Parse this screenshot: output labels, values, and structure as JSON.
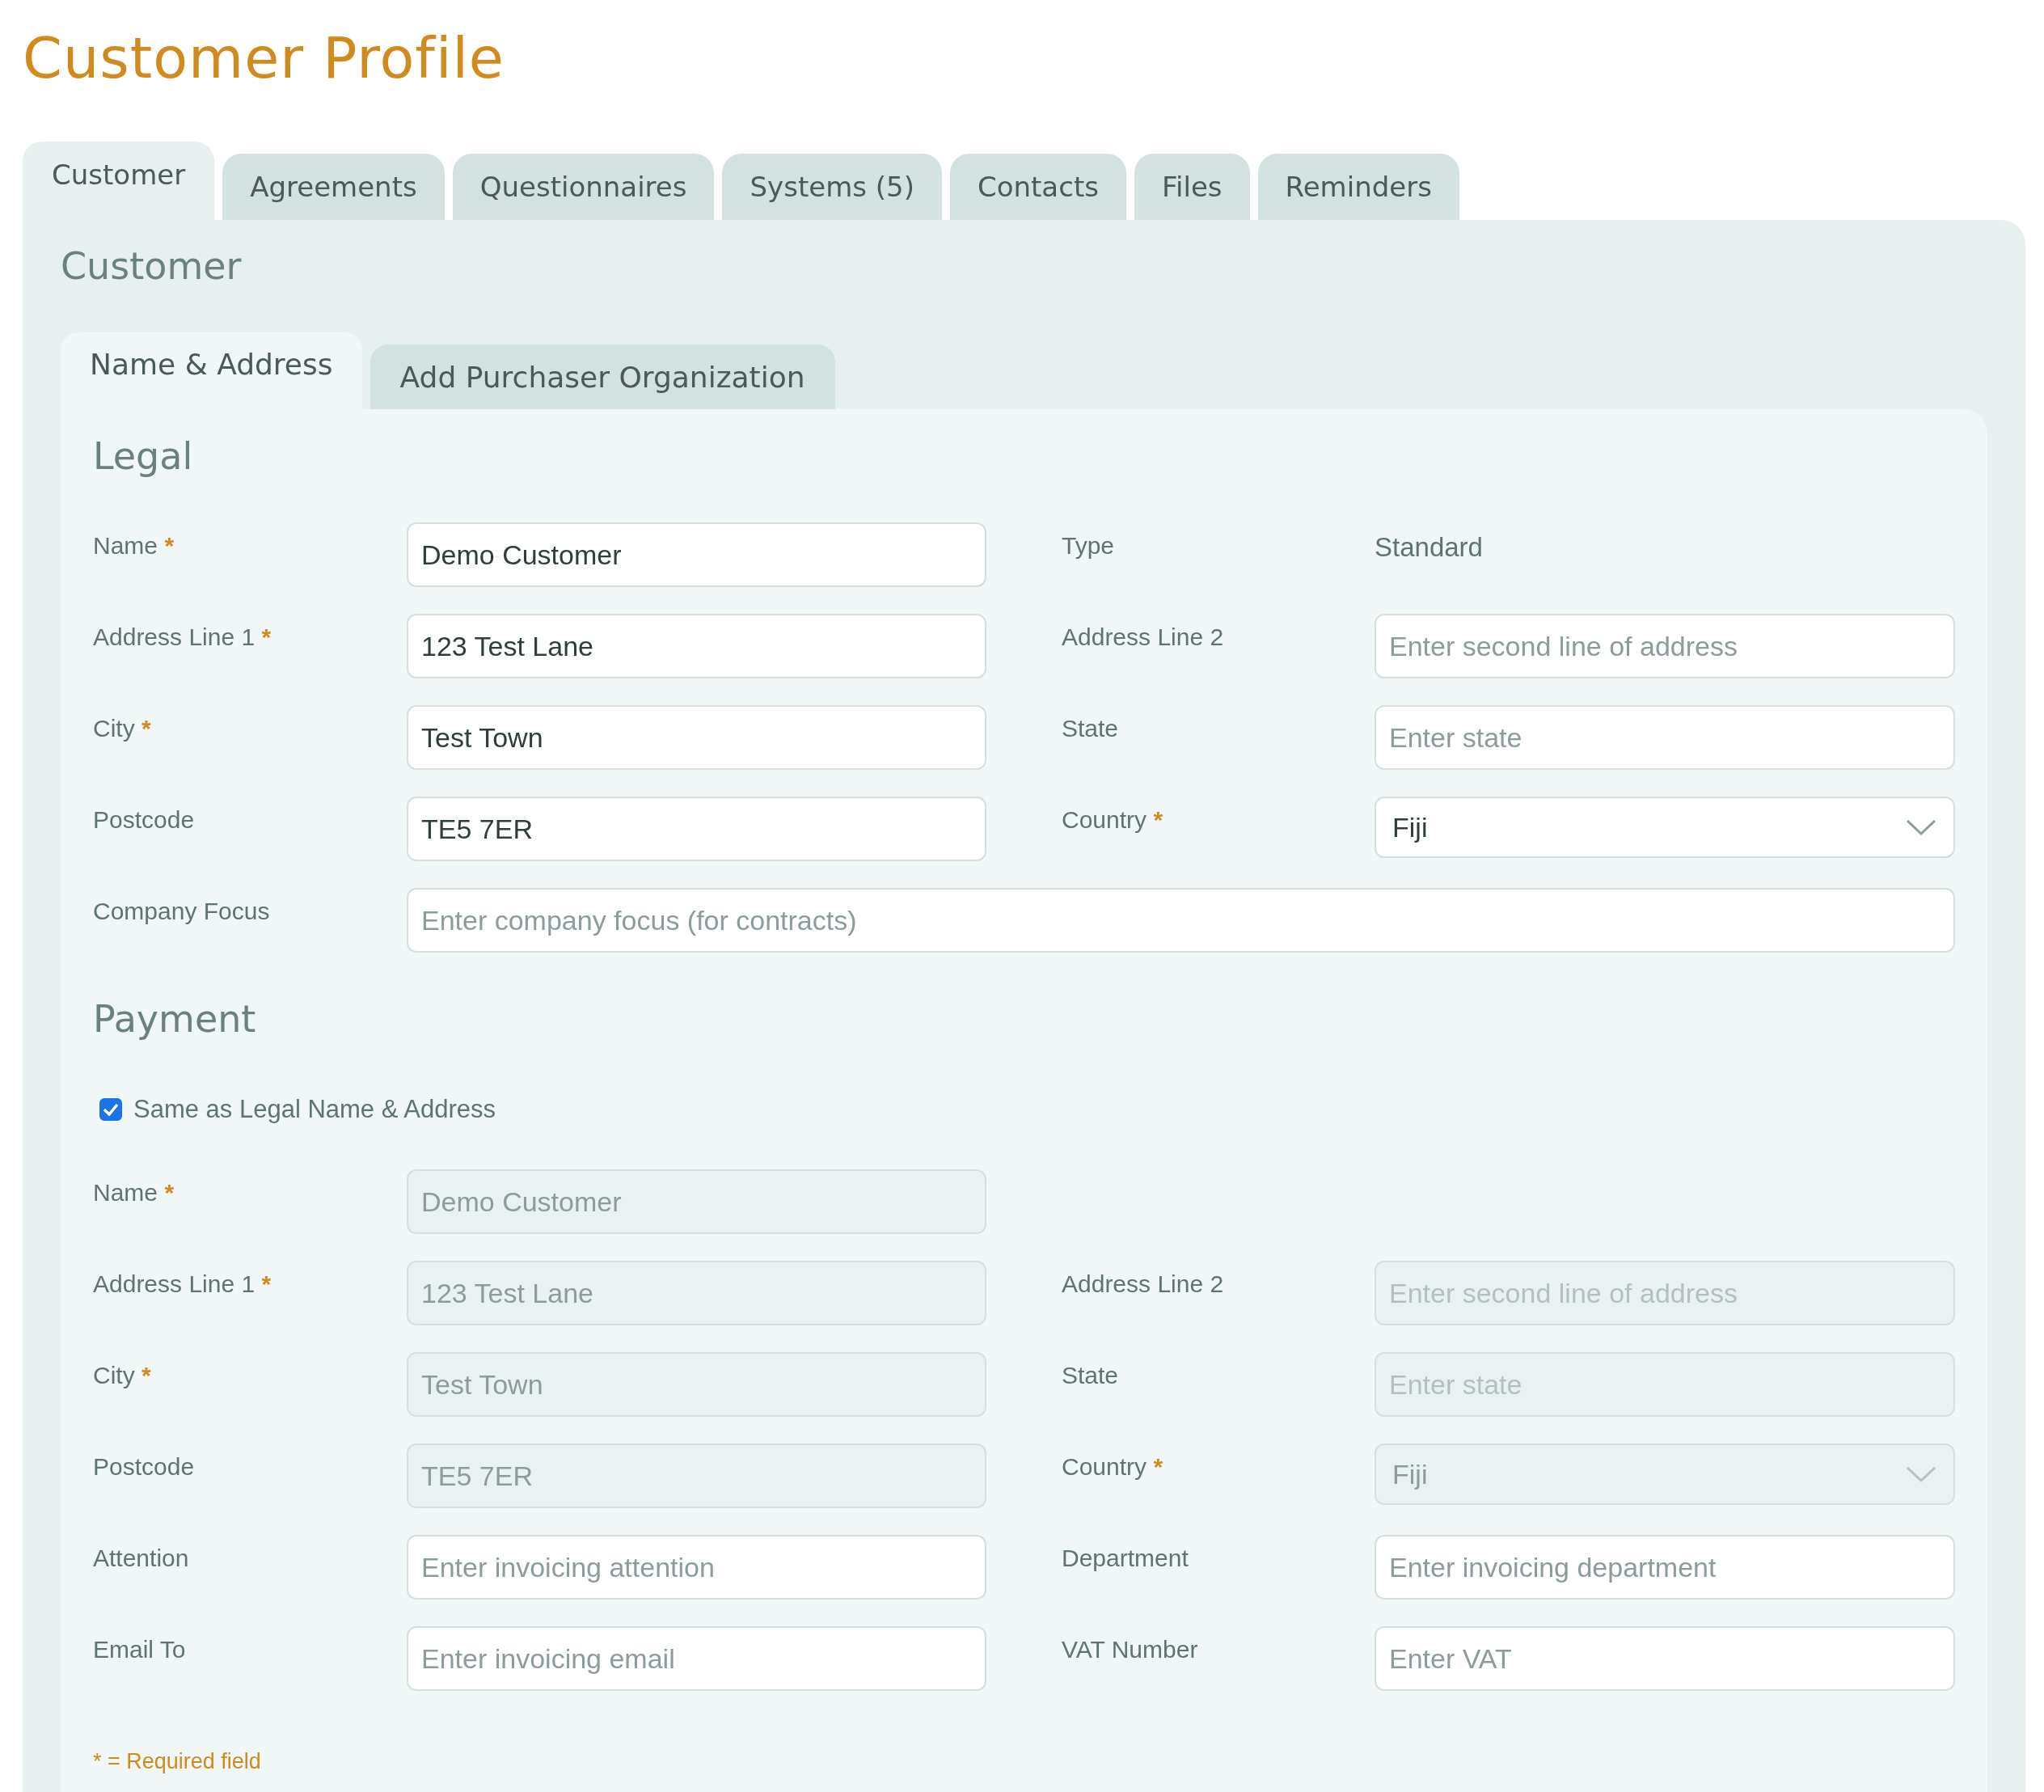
{
  "title": "Customer Profile",
  "tabs": [
    {
      "label": "Customer",
      "selected": true
    },
    {
      "label": "Agreements",
      "selected": false
    },
    {
      "label": "Questionnaires",
      "selected": false
    },
    {
      "label": "Systems (5)",
      "selected": false
    },
    {
      "label": "Contacts",
      "selected": false
    },
    {
      "label": "Files",
      "selected": false
    },
    {
      "label": "Reminders",
      "selected": false
    }
  ],
  "section": {
    "heading": "Customer",
    "subtabs": [
      {
        "label": "Name & Address",
        "selected": true
      },
      {
        "label": "Add Purchaser Organization",
        "selected": false
      }
    ],
    "legal": {
      "heading": "Legal",
      "rows": [
        {
          "fields": [
            {
              "kind": "input",
              "label": "Name",
              "mark": "*",
              "value": "Demo Customer",
              "disabled": false
            },
            {
              "kind": "static",
              "label": "Type",
              "value": "Standard"
            }
          ]
        },
        {
          "fields": [
            {
              "kind": "input",
              "label": "Address Line 1",
              "mark": "*",
              "value": "123 Test Lane",
              "disabled": false
            },
            {
              "kind": "input",
              "label": "Address Line 2",
              "placeholder": "Enter second line of address",
              "disabled": false
            }
          ]
        },
        {
          "fields": [
            {
              "kind": "input",
              "label": "City",
              "mark": "*",
              "value": "Test Town",
              "disabled": false
            },
            {
              "kind": "input",
              "label": "State",
              "placeholder": "Enter state",
              "disabled": false
            }
          ]
        },
        {
          "fields": [
            {
              "kind": "input",
              "label": "Postcode",
              "value": "TE5 7ER",
              "disabled": false
            },
            {
              "kind": "select",
              "label": "Country",
              "mark": "*",
              "value": "Fiji",
              "disabled": false
            }
          ]
        },
        {
          "fields": [
            {
              "kind": "input",
              "label": "Company Focus",
              "placeholder": "Enter company focus (for contracts)",
              "disabled": false,
              "wide": true
            }
          ]
        }
      ]
    },
    "payment": {
      "heading": "Payment",
      "same_as_legal": {
        "label": "Same as Legal Name & Address",
        "checked": true
      },
      "rows": [
        {
          "fields": [
            {
              "kind": "input",
              "label": "Name",
              "mark": "*",
              "value": "Demo Customer",
              "disabled": true
            }
          ]
        },
        {
          "fields": [
            {
              "kind": "input",
              "label": "Address Line 1",
              "mark": "*",
              "value": "123 Test Lane",
              "disabled": true
            },
            {
              "kind": "input",
              "label": "Address Line 2",
              "placeholder": "Enter second line of address",
              "disabled": true
            }
          ]
        },
        {
          "fields": [
            {
              "kind": "input",
              "label": "City",
              "mark": "*",
              "value": "Test Town",
              "disabled": true
            },
            {
              "kind": "input",
              "label": "State",
              "placeholder": "Enter state",
              "disabled": true
            }
          ]
        },
        {
          "fields": [
            {
              "kind": "input",
              "label": "Postcode",
              "value": "TE5 7ER",
              "disabled": true
            },
            {
              "kind": "select",
              "label": "Country",
              "mark": "*",
              "value": "Fiji",
              "disabled": true
            }
          ]
        },
        {
          "fields": [
            {
              "kind": "input",
              "label": "Attention",
              "placeholder": "Enter invoicing attention",
              "disabled": false
            },
            {
              "kind": "input",
              "label": "Department",
              "placeholder": "Enter invoicing department",
              "disabled": false
            }
          ]
        },
        {
          "fields": [
            {
              "kind": "input",
              "label": "Email To",
              "placeholder": "Enter invoicing email",
              "disabled": false
            },
            {
              "kind": "input",
              "label": "VAT Number",
              "placeholder": "Enter VAT",
              "disabled": false
            }
          ]
        }
      ]
    },
    "required_note": "* = Required field"
  }
}
